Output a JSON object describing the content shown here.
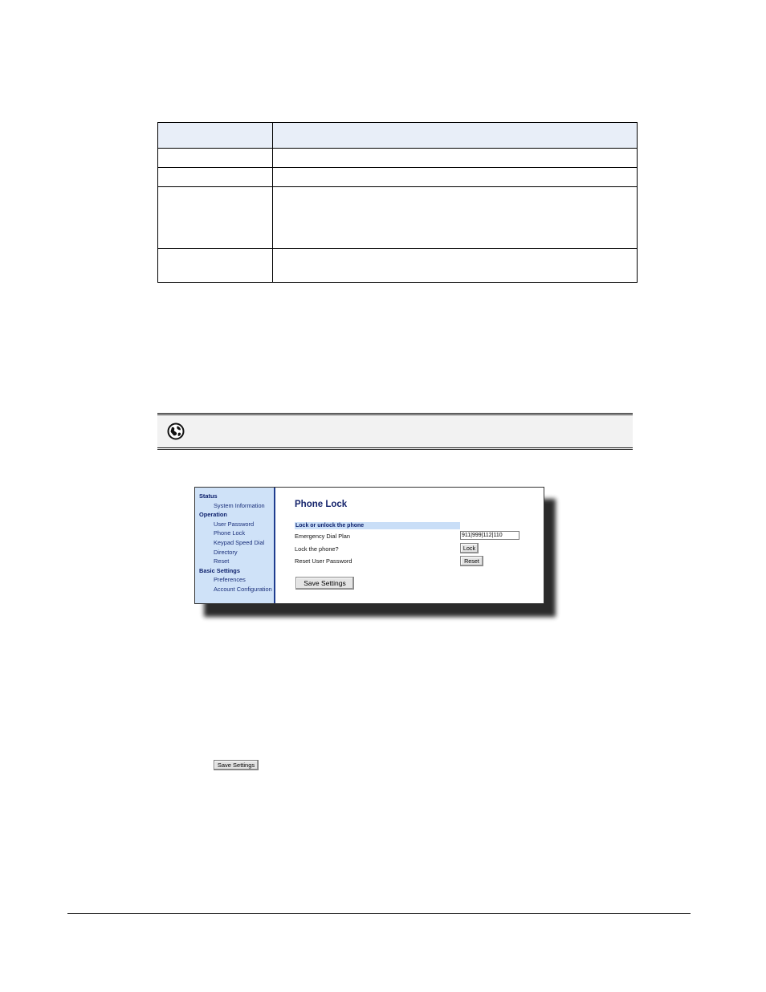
{
  "screenshot": {
    "nav": [
      {
        "type": "head",
        "label": "Status"
      },
      {
        "type": "item",
        "label": "System Information"
      },
      {
        "type": "head",
        "label": "Operation"
      },
      {
        "type": "item",
        "label": "User Password"
      },
      {
        "type": "item",
        "label": "Phone Lock"
      },
      {
        "type": "item",
        "label": "Keypad Speed Dial"
      },
      {
        "type": "item",
        "label": "Directory"
      },
      {
        "type": "item",
        "label": "Reset"
      },
      {
        "type": "head",
        "label": "Basic Settings"
      },
      {
        "type": "item",
        "label": "Preferences"
      },
      {
        "type": "item",
        "label": "Account Configuration"
      }
    ],
    "title": "Phone Lock",
    "section": "Lock or unlock the phone",
    "emergency_label": "Emergency Dial Plan",
    "emergency_value": "911|999|112|110",
    "lock_label": "Lock the phone?",
    "lock_button": "Lock",
    "reset_label": "Reset User Password",
    "reset_button": "Reset",
    "save_button": "Save Settings"
  },
  "inline_save_button": "Save Settings",
  "icons": {
    "note": "globe-icon"
  }
}
